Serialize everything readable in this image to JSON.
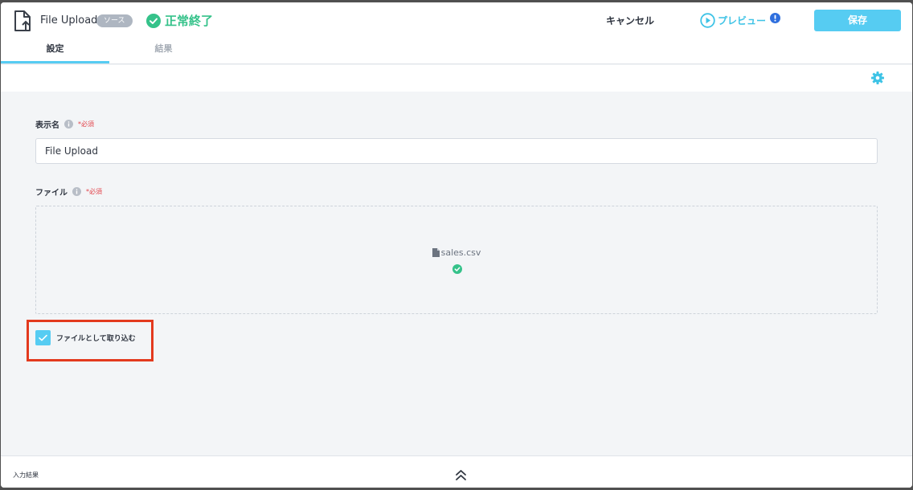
{
  "header": {
    "icon": "file-upload-icon",
    "title": "File Upload",
    "badge": "ソース",
    "status": {
      "icon": "check-circle-icon",
      "text": "正常終了",
      "color": "#35c28a"
    },
    "cancel_label": "キャンセル",
    "preview": {
      "icon": "play-circle-icon",
      "label": "プレビュー",
      "alert_icon": "alert-icon"
    },
    "save_label": "保存"
  },
  "tabs": [
    {
      "label": "設定",
      "active": true
    },
    {
      "label": "結果",
      "active": false
    }
  ],
  "toolbar": {
    "settings_icon": "gear-icon"
  },
  "form": {
    "display_name": {
      "label": "表示名",
      "info_icon": "info-icon",
      "required": "*必須",
      "value": "File Upload"
    },
    "file": {
      "label": "ファイル",
      "info_icon": "info-icon",
      "required": "*必須",
      "file_icon": "document-icon",
      "filename": "sales.csv",
      "status_icon": "check-circle-icon"
    },
    "import_as_file": {
      "label": "ファイルとして取り込む",
      "checked": true
    }
  },
  "footer": {
    "label": "入力結果",
    "toggle_icon": "double-chevron-up-icon"
  },
  "colors": {
    "accent": "#56ccf2",
    "success": "#35c28a",
    "required": "#e2434a",
    "highlight": "#e33a1e",
    "badge": "#aeb6c1"
  }
}
